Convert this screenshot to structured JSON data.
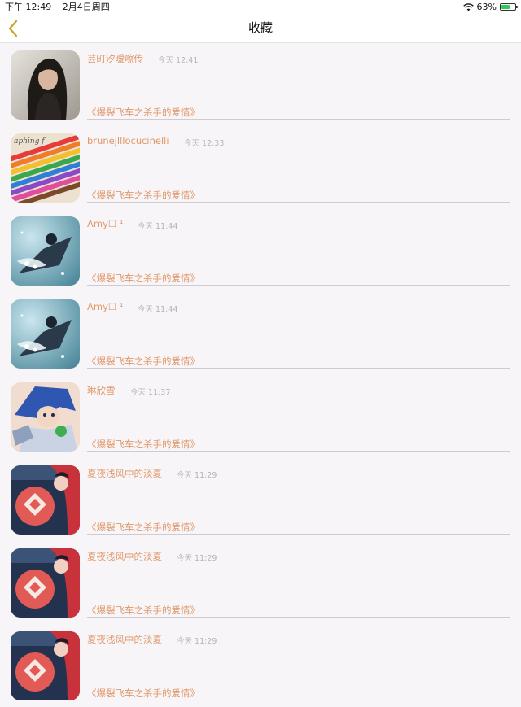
{
  "status": {
    "time": "下午 12:49",
    "date": "2月4日周四",
    "battery": "63%",
    "battery_level": 0.63
  },
  "header": {
    "title": "收藏"
  },
  "favorites": [
    {
      "username": "芸町汐暧嚓传",
      "time": "今天 12:41",
      "message": "《爆裂飞车之杀手的爱情》",
      "avatar": "portrait-photo-avatar"
    },
    {
      "username": "brunejlllocucinelli",
      "time": "今天 12:33",
      "message": "《爆裂飞车之杀手的爱情》",
      "avatar": "colored-pencils-avatar"
    },
    {
      "username": "Amy☐ ¹",
      "time": "今天 11:44",
      "message": "《爆裂飞车之杀手的爱情》",
      "avatar": "anime-teal-avatar"
    },
    {
      "username": "Amy☐ ¹",
      "time": "今天 11:44",
      "message": "《爆裂飞车之杀手的爱情》",
      "avatar": "anime-teal-avatar"
    },
    {
      "username": "琳欣雪",
      "time": "今天 11:37",
      "message": "《爆裂飞车之杀手的爱情》",
      "avatar": "anime-blue-hair-avatar"
    },
    {
      "username": "夏夜浅风中的淡夏",
      "time": "今天 11:29",
      "message": "《爆裂飞车之杀手的爱情》",
      "avatar": "anime-red-emblem-avatar"
    },
    {
      "username": "夏夜浅风中的淡夏",
      "time": "今天 11:29",
      "message": "《爆裂飞车之杀手的爱情》",
      "avatar": "anime-red-emblem-avatar"
    },
    {
      "username": "夏夜浅风中的淡夏",
      "time": "今天 11:29",
      "message": "《爆裂飞车之杀手的爱情》",
      "avatar": "anime-red-emblem-avatar"
    }
  ],
  "colors": {
    "accent": "#e0986a",
    "timestamp": "#b8b3b6",
    "back_arrow": "#c9a227",
    "battery_fill": "#34c759"
  }
}
